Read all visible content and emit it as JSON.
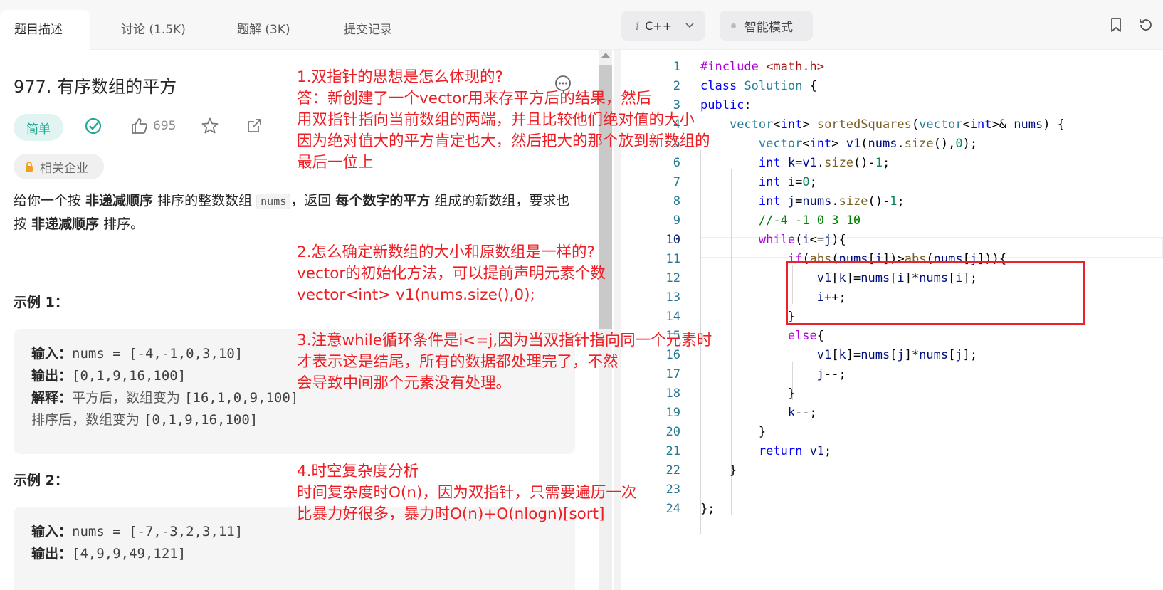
{
  "tabs": [
    {
      "label": "题目描述",
      "active": true
    },
    {
      "label": "讨论 (1.5K)",
      "active": false
    },
    {
      "label": "题解 (3K)",
      "active": false
    },
    {
      "label": "提交记录",
      "active": false
    }
  ],
  "editor_toolbar": {
    "language_prefix": "i",
    "language": "C++",
    "mode": "智能模式",
    "icons": [
      "bookmark-icon",
      "reset-icon",
      "chevron-down-icon"
    ]
  },
  "problem": {
    "title": "977. 有序数组的平方",
    "difficulty": "简单",
    "likes": "695",
    "company_tag": "相关企业",
    "description": {
      "p1": "给你一个按 ",
      "b1": "非递减顺序",
      "p2": " 排序的整数数组 ",
      "code": "nums",
      "p3": "，返回 ",
      "b2": "每个数字的平方",
      "p4": " 组成的新数组，要求也按 ",
      "b3": "非递减顺序",
      "p5": " 排序。"
    },
    "example1": {
      "title": "示例 1：",
      "input_label": "输入：",
      "input": "nums = [-4,-1,0,3,10]",
      "output_label": "输出：",
      "output": "[0,1,9,16,100]",
      "explain_label": "解释：",
      "explain_1": "平方后，数组变为",
      "explain_1_val": "[16,1,0,9,100]",
      "explain_2": "排序后，数组变为",
      "explain_2_val": "[0,1,9,16,100]"
    },
    "example2": {
      "title": "示例 2：",
      "input_label": "输入：",
      "input": "nums = [-7,-3,2,3,11]",
      "output_label": "输出：",
      "output": "[4,9,9,49,121]"
    }
  },
  "code_lines": [
    "#include <math.h>",
    "class Solution {",
    "public:",
    "    vector<int> sortedSquares(vector<int>& nums) {",
    "        vector<int> v1(nums.size(),0);",
    "        int k=v1.size()-1;",
    "        int i=0;",
    "        int j=nums.size()-1;",
    "        //-4 -1 0 3 10",
    "        while(i<=j){",
    "            if(abs(nums[i])>abs(nums[j])){",
    "                v1[k]=nums[i]*nums[i];",
    "                i++;",
    "            }",
    "            else{",
    "                v1[k]=nums[j]*nums[j];",
    "                j--;",
    "            }",
    "            k--;",
    "        }",
    "        return v1;",
    "    }",
    "",
    "};"
  ],
  "line_numbers": [
    "1",
    "2",
    "3",
    "4",
    "5",
    "6",
    "7",
    "8",
    "9",
    "10",
    "11",
    "12",
    "13",
    "14",
    "15",
    "16",
    "17",
    "18",
    "19",
    "20",
    "21",
    "22",
    "23",
    "24"
  ],
  "current_line": 10,
  "annotation_color": "#ee1f24",
  "annotations": {
    "n1": [
      "1.双指针的思想是怎么体现的?",
      "答：新创建了一个vector用来存平方后的结果，然后",
      "用双指针指向当前数组的两端，并且比较他们绝对值的大小",
      "因为绝对值大的平方肯定也大，然后把大的那个放到新数组的",
      "最后一位上"
    ],
    "n2": [
      "2.怎么确定新数组的大小和原数组是一样的?",
      "vector的初始化方法，可以提前声明元素个数",
      "vector<int> v1(nums.size(),0);"
    ],
    "n3": [
      "3.注意while循环条件是i<=j,因为当双指针指向同一个元素时",
      "才表示这是结尾，所有的数据都处理完了，不然",
      "会导致中间那个元素没有处理。"
    ],
    "n4": [
      "4.时空复杂度分析",
      "时间复杂度时O(n)，因为双指针，只需要遍历一次",
      "比暴力好很多，暴力时O(n)+O(nlogn)[sort]"
    ]
  }
}
